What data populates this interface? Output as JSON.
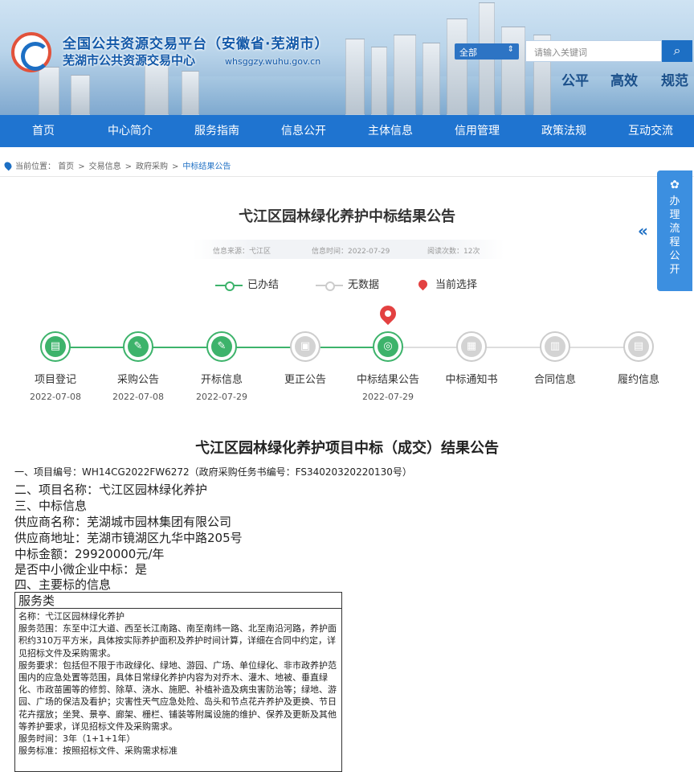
{
  "header": {
    "site_title": "全国公共资源交易平台（安徽省·芜湖市）",
    "site_subtitle": "芜湖市公共资源交易中心",
    "site_url": "whsggzy.wuhu.gov.cn",
    "search_scope": "全部",
    "search_placeholder": "请输入关键词",
    "slogans": [
      "公平",
      "高效",
      "规范"
    ]
  },
  "nav": [
    "首页",
    "中心简介",
    "服务指南",
    "信息公开",
    "主体信息",
    "信用管理",
    "政策法规",
    "互动交流"
  ],
  "breadcrumb": {
    "prefix": "当前位置：",
    "items": [
      "首页",
      "交易信息",
      "政府采购"
    ],
    "current": "中标结果公告"
  },
  "side_panel": {
    "label": "办理流程公开",
    "arrows": "«"
  },
  "page_title": "弋江区园林绿化养护中标结果公告",
  "meta": {
    "source": "信息来源：弋江区",
    "time": "信息时间：2022-07-29",
    "views": "阅读次数：12次"
  },
  "legend": {
    "done": "已办结",
    "none": "无数据",
    "current": "当前选择"
  },
  "timeline": [
    {
      "label": "项目登记",
      "date": "2022-07-08",
      "status": "done",
      "icon": "folder-icon"
    },
    {
      "label": "采购公告",
      "date": "2022-07-08",
      "status": "done",
      "icon": "document-edit-icon"
    },
    {
      "label": "开标信息",
      "date": "2022-07-29",
      "status": "done",
      "icon": "document-edit-icon"
    },
    {
      "label": "更正公告",
      "date": "",
      "status": "todo",
      "icon": "correction-icon"
    },
    {
      "label": "中标结果公告",
      "date": "2022-07-29",
      "status": "done",
      "icon": "target-icon"
    },
    {
      "label": "中标通知书",
      "date": "",
      "status": "todo",
      "icon": "notice-icon"
    },
    {
      "label": "合同信息",
      "date": "",
      "status": "todo",
      "icon": "contract-icon"
    },
    {
      "label": "履约信息",
      "date": "",
      "status": "todo",
      "icon": "performance-icon"
    }
  ],
  "notice": {
    "title": "弋江区园林绿化养护项目中标（成交）结果公告",
    "project_no": "一、项目编号：WH14CG2022FW6272（政府采购任务书编号：FS34020320220130号）",
    "project_name": "二、项目名称：弋江区园林绿化养护",
    "section3": "三、中标信息",
    "supplier_name": "供应商名称：芜湖城市园林集团有限公司",
    "supplier_address": "供应商地址：芜湖市镜湖区九华中路205号",
    "bid_amount": "中标金额：29920000元/年",
    "sme": "是否中小微企业中标：是",
    "section4": "四、主要标的信息",
    "box_header": "服务类",
    "box_name": "名称：弋江区园林绿化养护",
    "box_scope": "服务范围：东至中江大道、西至长江南路、南至南纬一路、北至南沿河路，养护面积约310万平方米，具体按实际养护面积及养护时间计算，详细在合同中约定，详见招标文件及采购需求。",
    "box_requirements": "服务要求：包括但不限于市政绿化、绿地、游园、广场、单位绿化、非市政养护范围内的应急处置等范围，具体日常绿化养护内容为对乔木、灌木、地被、垂直绿化、市政苗圃等的修剪、除草、浇水、施肥、补植补造及病虫害防治等；绿地、游园、广场的保洁及看护；灾害性天气应急处险、岛头和节点花卉养护及更换、节日花卉摆放；坐凳、景亭、廊架、栅栏、铺装等附属设施的维护、保养及更新及其他等养护要求，详见招标文件及采购需求。",
    "box_time": "服务时间：3年（1+1+1年）",
    "box_standard": "服务标准：按照招标文件、采购需求标准"
  },
  "colors": {
    "nav": "#1f74d0",
    "done": "#3db36b",
    "todo": "#cccccc",
    "current": "#e34141"
  }
}
